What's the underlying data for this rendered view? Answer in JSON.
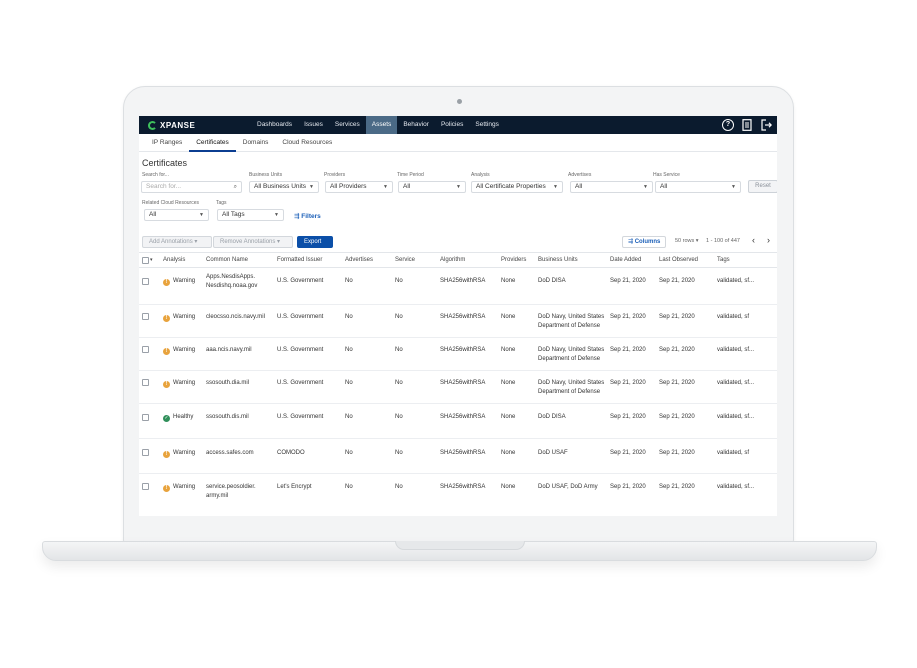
{
  "brand": {
    "name": "XPANSE"
  },
  "nav": {
    "items": [
      {
        "label": "Dashboards"
      },
      {
        "label": "Issues"
      },
      {
        "label": "Services"
      },
      {
        "label": "Assets"
      },
      {
        "label": "Behavior"
      },
      {
        "label": "Policies"
      },
      {
        "label": "Settings"
      }
    ],
    "active": "Assets",
    "help_icon": "help-icon",
    "doc_icon": "document-icon",
    "logout_icon": "logout-icon"
  },
  "subtabs": [
    {
      "label": "IP Ranges"
    },
    {
      "label": "Certificates"
    },
    {
      "label": "Domains"
    },
    {
      "label": "Cloud Resources"
    }
  ],
  "page": {
    "title": "Certificates"
  },
  "filters": {
    "search_label": "Search for...",
    "search_placeholder": "Search for...",
    "business_units_label": "Business Units",
    "business_units_value": "All Business Units",
    "providers_label": "Providers",
    "providers_value": "All Providers",
    "time_period_label": "Time Period",
    "time_period_value": "All",
    "analysis_label": "Analysis",
    "analysis_value": "All Certificate Properties",
    "advertises_label": "Advertises",
    "advertises_value": "All",
    "has_service_label": "Has Service",
    "has_service_value": "All",
    "reset_label": "Reset",
    "related_cloud_label": "Related Cloud Resources",
    "related_cloud_value": "All",
    "tags_label": "Tags",
    "tags_value": "All Tags",
    "filters_link": "Filters"
  },
  "toolbar": {
    "add_annotations": "Add Annotations",
    "remove_annotations": "Remove Annotations",
    "export": "Export",
    "columns": "Columns",
    "rows_per_page": "50 rows",
    "range": "1 - 100 of 447"
  },
  "table": {
    "headers": [
      "Analysis",
      "Common Name",
      "Formatted Issuer",
      "Advertises",
      "Service",
      "Algorithm",
      "Providers",
      "Business Units",
      "Date Added",
      "Last Observed",
      "Tags"
    ],
    "rows": [
      {
        "status": "warning",
        "analysis": "Warning",
        "cn1": "Apps.NesdisApps.",
        "cn2": "Nesdishq.noaa.gov",
        "issuer": "U.S. Government",
        "advertises": "No",
        "service": "No",
        "algorithm": "SHA256withRSA",
        "providers": "None",
        "bu1": "DoD DISA",
        "bu2": "",
        "date_added": "Sep 21, 2020",
        "last_observed": "Sep 21, 2020",
        "tags": "validated, sf..."
      },
      {
        "status": "warning",
        "analysis": "Warning",
        "cn1": "cleocsso.ncis.navy.mil",
        "cn2": "",
        "issuer": "U.S. Government",
        "advertises": "No",
        "service": "No",
        "algorithm": "SHA256withRSA",
        "providers": "None",
        "bu1": "DoD Navy, United States",
        "bu2": "Department of Defense",
        "date_added": "Sep 21, 2020",
        "last_observed": "Sep 21, 2020",
        "tags": "validated, sf"
      },
      {
        "status": "warning",
        "analysis": "Warning",
        "cn1": "aaa.ncis.navy.mil",
        "cn2": "",
        "issuer": "U.S. Government",
        "advertises": "No",
        "service": "No",
        "algorithm": "SHA256withRSA",
        "providers": "None",
        "bu1": "DoD Navy, United States",
        "bu2": "Department of Defense",
        "date_added": "Sep 21, 2020",
        "last_observed": "Sep 21, 2020",
        "tags": "validated, sf..."
      },
      {
        "status": "warning",
        "analysis": "Warning",
        "cn1": "ssosouth.dia.mil",
        "cn2": "",
        "issuer": "U.S. Government",
        "advertises": "No",
        "service": "No",
        "algorithm": "SHA256withRSA",
        "providers": "None",
        "bu1": "DoD Navy, United States",
        "bu2": "Department of Defense",
        "date_added": "Sep 21, 2020",
        "last_observed": "Sep 21, 2020",
        "tags": "validated, sf..."
      },
      {
        "status": "healthy",
        "analysis": "Healthy",
        "cn1": "ssosouth.dis.mil",
        "cn2": "",
        "issuer": "U.S. Government",
        "advertises": "No",
        "service": "No",
        "algorithm": "SHA256withRSA",
        "providers": "None",
        "bu1": "DoD DISA",
        "bu2": "",
        "date_added": "Sep 21, 2020",
        "last_observed": "Sep 21, 2020",
        "tags": "validated, sf..."
      },
      {
        "status": "warning",
        "analysis": "Warning",
        "cn1": "access.safes.com",
        "cn2": "",
        "issuer": "COMODO",
        "advertises": "No",
        "service": "No",
        "algorithm": "SHA256withRSA",
        "providers": "None",
        "bu1": "DoD USAF",
        "bu2": "",
        "date_added": "Sep 21, 2020",
        "last_observed": "Sep 21, 2020",
        "tags": "validated, sf"
      },
      {
        "status": "warning",
        "analysis": "Warning",
        "cn1": "service.peosoldier.",
        "cn2": "army.mil",
        "issuer": "Let's Encrypt",
        "advertises": "No",
        "service": "No",
        "algorithm": "SHA256withRSA",
        "providers": "None",
        "bu1": "DoD USAF, DoD Army",
        "bu2": "",
        "date_added": "Sep 21, 2020",
        "last_observed": "Sep 21, 2020",
        "tags": "validated, sf..."
      }
    ]
  },
  "colors": {
    "nav_bg": "#0b1b2e",
    "nav_active": "#4b6a86",
    "primary": "#0b4fa8",
    "warning": "#e8a33d",
    "healthy": "#2f8f5a"
  }
}
